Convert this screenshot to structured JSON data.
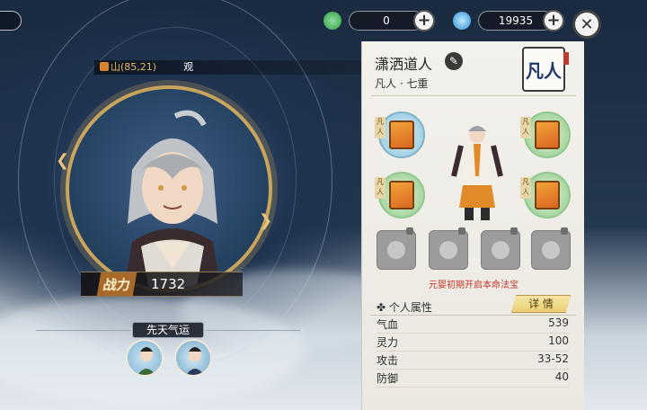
{
  "resources": [
    {
      "name": "jade",
      "icon": "green-ring-icon",
      "value": "0"
    },
    {
      "name": "spirit-stone",
      "icon": "blue-crystal-icon",
      "value": "19935"
    }
  ],
  "ticker_text": "山(85,21)",
  "ticker_suffix": "观",
  "power": {
    "label": "战力",
    "value": "1732"
  },
  "fate": {
    "label": "先天气运"
  },
  "character": {
    "name": "潇洒道人",
    "realm": "凡人 · 七重",
    "seal_text": "凡人",
    "item_tag": "凡人"
  },
  "hint": "元婴初期开启本命法宝",
  "attributes": {
    "title": "个人属性",
    "detail_label": "详 情",
    "rows": [
      {
        "label": "气血",
        "value": "539"
      },
      {
        "label": "灵力",
        "value": "100"
      },
      {
        "label": "攻击",
        "value": "33-52"
      },
      {
        "label": "防御",
        "value": "40"
      }
    ]
  },
  "colors": {
    "gold": "#c9a45c",
    "hint_red": "#c0392b",
    "panel_bg": "#f3f1ec"
  }
}
